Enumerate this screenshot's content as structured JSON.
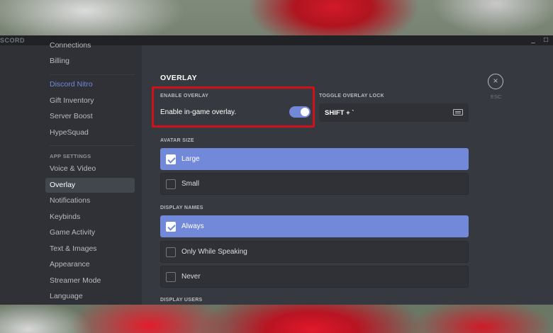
{
  "window": {
    "app_name": "SCORD",
    "minimize": "_",
    "maximize": "□"
  },
  "sidebar": {
    "items_top": [
      {
        "label": "Connections"
      },
      {
        "label": "Billing"
      }
    ],
    "nitro": {
      "label": "Discord Nitro"
    },
    "items_nitro": [
      {
        "label": "Gift Inventory"
      },
      {
        "label": "Server Boost"
      },
      {
        "label": "HypeSquad"
      }
    ],
    "app_settings_header": "APP SETTINGS",
    "app_items": [
      {
        "label": "Voice & Video"
      },
      {
        "label": "Overlay"
      },
      {
        "label": "Notifications"
      },
      {
        "label": "Keybinds"
      },
      {
        "label": "Game Activity"
      },
      {
        "label": "Text & Images"
      },
      {
        "label": "Appearance"
      },
      {
        "label": "Streamer Mode"
      },
      {
        "label": "Language"
      }
    ],
    "active": "Overlay"
  },
  "overlay": {
    "title": "OVERLAY",
    "enable_label": "ENABLE OVERLAY",
    "enable_text": "Enable in-game overlay.",
    "enable_on": true,
    "lock_label": "TOGGLE OVERLAY LOCK",
    "lock_value": "SHIFT + `",
    "avatar_label": "AVATAR SIZE",
    "avatar_options": [
      {
        "label": "Large",
        "selected": true
      },
      {
        "label": "Small",
        "selected": false
      }
    ],
    "names_label": "DISPLAY NAMES",
    "names_options": [
      {
        "label": "Always",
        "selected": true
      },
      {
        "label": "Only While Speaking",
        "selected": false
      },
      {
        "label": "Never",
        "selected": false
      }
    ],
    "users_label": "DISPLAY USERS"
  },
  "close": {
    "icon": "×",
    "label": "ESC"
  },
  "colors": {
    "accent": "#7289da",
    "highlight_border": "#d1101a",
    "background": "#36393f",
    "sidebar": "#2f3136"
  }
}
